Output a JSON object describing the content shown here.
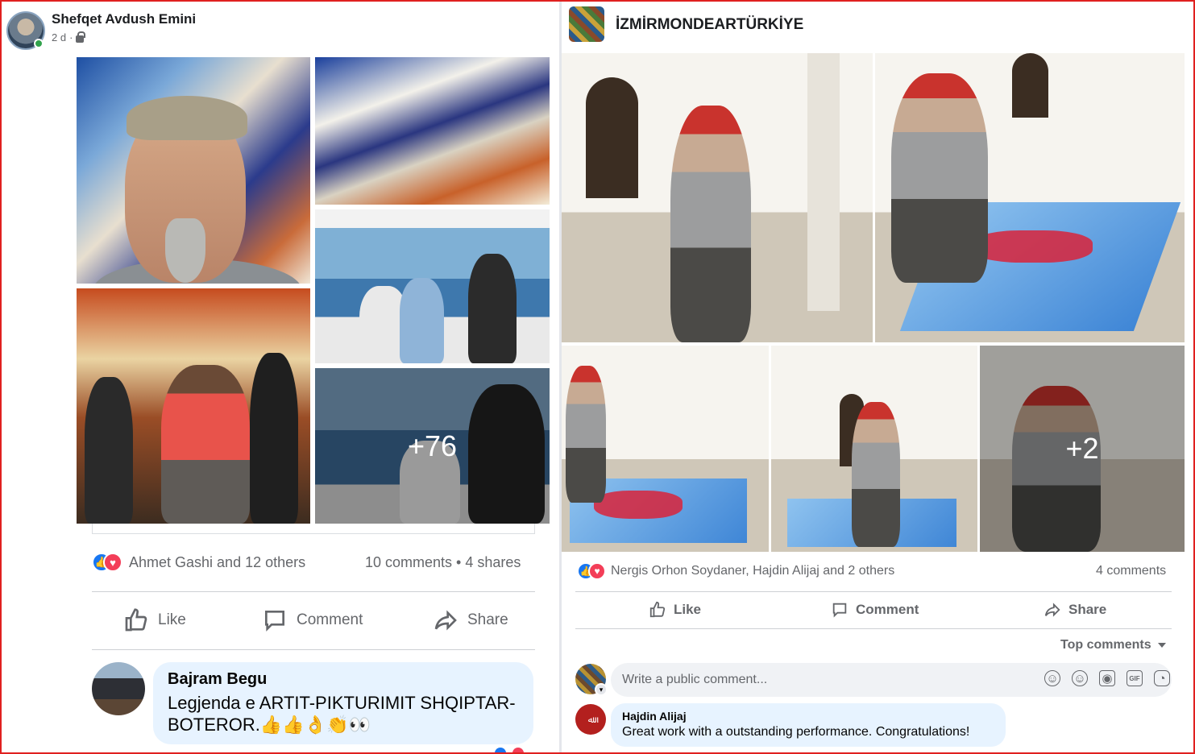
{
  "left_post": {
    "author": "Shefqet Avdush Emini",
    "time": "2 d",
    "privacy_icon": "lock-icon",
    "more_photos": "+76",
    "reactions_text": "Ahmet Gashi and 12 others",
    "counts_text": "10 comments • 4 shares",
    "actions": {
      "like": "Like",
      "comment": "Comment",
      "share": "Share"
    },
    "comment": {
      "author": "Bajram Begu",
      "text": "Legjenda e ARTIT-PIKTURIMIT SHQIPTAR-BOTEROR.👍👍👌👏👀"
    }
  },
  "right_post": {
    "author": "İZMİRMONDEARTÜRKİYE",
    "more_photos": "+2",
    "reactions_text": "Nergis Orhon Soydaner, Hajdin Alijaj and 2 others",
    "comments_count": "4 comments",
    "actions": {
      "like": "Like",
      "comment": "Comment",
      "share": "Share"
    },
    "sort_label": "Top comments",
    "input_placeholder": "Write a public comment...",
    "comment": {
      "author": "Hajdin Alijaj",
      "text": "Great work with a outstanding performance. Congratulations!"
    }
  },
  "colors": {
    "accent": "#1877f2",
    "love": "#f33e58",
    "bubble": "#e7f3ff",
    "frame": "#e0201f"
  }
}
